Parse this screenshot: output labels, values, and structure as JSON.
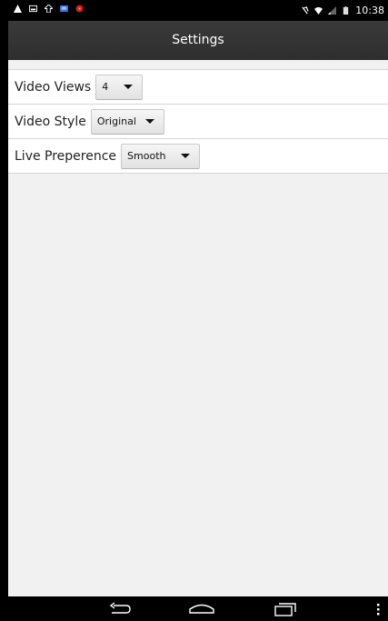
{
  "status_bar": {
    "time": "10:38",
    "left_icons": [
      "warning-icon",
      "image-icon",
      "upload-icon",
      "app-icon",
      "record-icon"
    ],
    "right_icons": [
      "mute-icon",
      "wifi-icon",
      "signal-icon",
      "battery-icon"
    ]
  },
  "header": {
    "title": "Settings"
  },
  "settings": {
    "video_views": {
      "label": "Video Views",
      "value": "4"
    },
    "video_style": {
      "label": "Video Style",
      "value": "Original"
    },
    "live_preference": {
      "label": "Live Preperence",
      "value": "Smooth"
    }
  },
  "nav_bar": {
    "buttons": [
      "back-icon",
      "home-icon",
      "recents-icon",
      "menu-icon"
    ]
  }
}
